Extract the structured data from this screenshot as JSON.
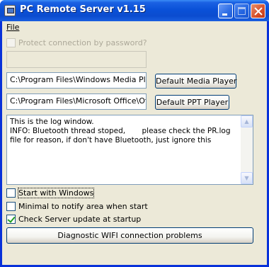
{
  "window": {
    "title": "PC Remote Server v1.15"
  },
  "menu": {
    "file_label": "File"
  },
  "password": {
    "protect_label": "Protect connection by password?",
    "protect_checked": false,
    "password_value": ""
  },
  "media_player": {
    "path": "C:\\Program Files\\Windows Media Player\\wmplayer.exe",
    "button_label": "Default Media Player"
  },
  "ppt_player": {
    "path": "C:\\Program Files\\Microsoft Office\\Office\\POWERPNT.EXE",
    "button_label": "Default PPT Player"
  },
  "log": {
    "text": "This is the log window.\nINFO: Bluetooth thread stoped,       please check the PR.log file for reason, if don't have Bluetooth, just ignore this"
  },
  "options": {
    "start_with_windows": "Start with Windows",
    "minimal_to_notify": "Minimal to notify area when start",
    "check_update": "Check Server update at startup"
  },
  "diagnostic_button": "Diagnostic WIFI connection problems"
}
